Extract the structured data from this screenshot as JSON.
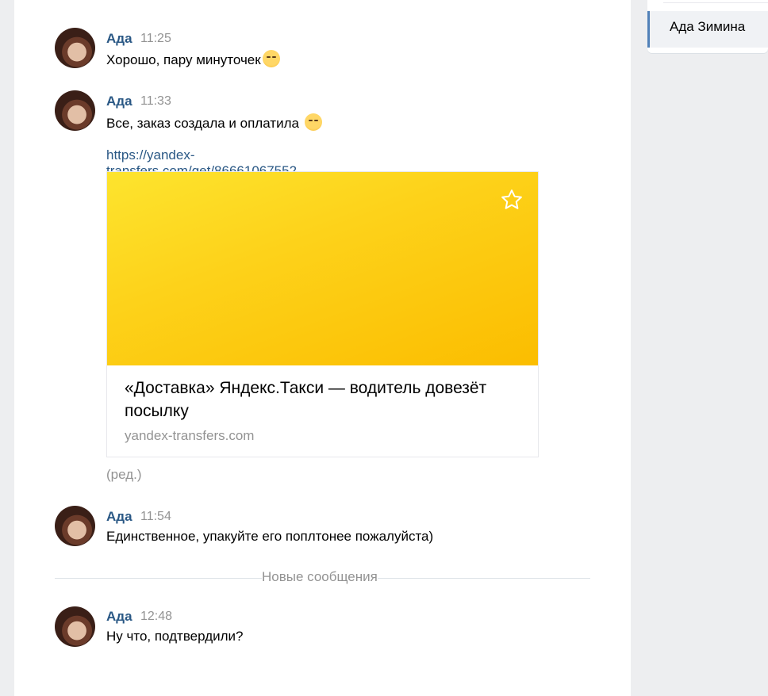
{
  "sidebar": {
    "selected_chat": "Ада Зимина"
  },
  "messages": [
    {
      "author": "Ада",
      "time": "11:25",
      "text": "Хорошо, пару минуточек",
      "emoji": "hugging-face"
    },
    {
      "author": "Ада",
      "time": "11:33",
      "text": "Все, заказ создала и оплатила ",
      "emoji": "relieved-face",
      "link": "https://yandex-transfers.com/get/86661067552",
      "card": {
        "title": "«Доставка» Яндекс.Такси — водитель довезёт посылку",
        "domain": "yandex-transfers.com",
        "image_color": "#fdd21a",
        "icon": "star-icon"
      },
      "edited": "(ред.)"
    },
    {
      "author": "Ада",
      "time": "11:54",
      "text": "Единственное, упакуйте его поплтонее пожалуйста)"
    },
    {
      "author": "Ада",
      "time": "12:48",
      "text": "Ну что, подтвердили?"
    }
  ],
  "new_messages_label": "Новые сообщения",
  "colors": {
    "author": "#2a5885",
    "link": "#2a5885",
    "muted": "#939393",
    "accent": "#5181b8"
  }
}
